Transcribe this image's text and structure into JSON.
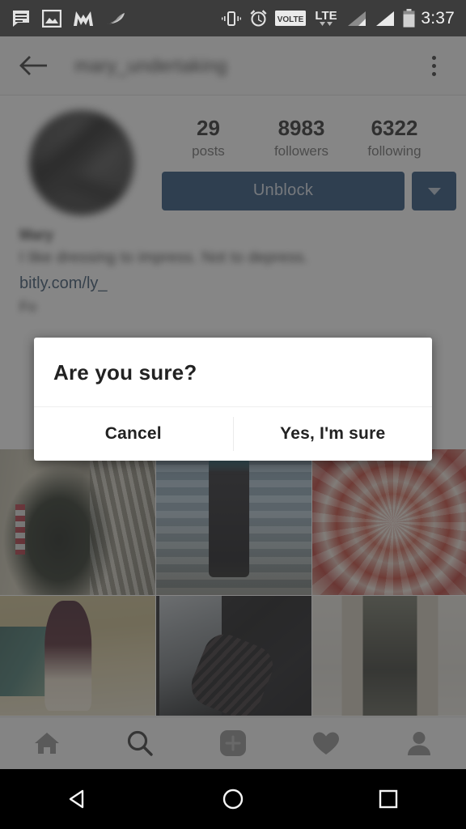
{
  "status_bar": {
    "background": "#3c3c3c",
    "time": "3:37",
    "left_icons": [
      {
        "name": "messages-icon",
        "label": "messages"
      },
      {
        "name": "photo-icon",
        "label": "photo"
      },
      {
        "name": "m-logo-icon",
        "label": "M"
      },
      {
        "name": "bird-icon",
        "label": "bird"
      }
    ],
    "right_icons": [
      {
        "name": "vibrate-icon",
        "label": "vibrate"
      },
      {
        "name": "alarm-icon",
        "label": "alarm"
      },
      {
        "name": "volte-icon",
        "label": "VOLTE"
      },
      {
        "name": "lte-icon",
        "label": "LTE"
      },
      {
        "name": "signal-icon-1",
        "label": "signal"
      },
      {
        "name": "signal-icon-2",
        "label": "signal"
      },
      {
        "name": "battery-icon",
        "label": "battery"
      }
    ]
  },
  "action_bar": {
    "back_label": "",
    "title": "mary_undertaking",
    "overflow_label": ""
  },
  "profile": {
    "stats": [
      {
        "number": "29",
        "label": "posts"
      },
      {
        "number": "8983",
        "label": "followers"
      },
      {
        "number": "6322",
        "label": "following"
      }
    ],
    "unblock_label": "Unblock",
    "dropdown_label": "",
    "bio_name": "Mary",
    "bio_text": "I like dressing to impress. Not to depress.",
    "bio_link": "bitly.com/ly_",
    "bio_tail": "Fo",
    "button_color": "#1c4471",
    "link_color": "#2f4b66"
  },
  "grid": {
    "tiles": [
      {
        "name": "post-thumbnail-1",
        "description": "christmas tree in station"
      },
      {
        "name": "post-thumbnail-2",
        "description": "person in dark outfit by wall"
      },
      {
        "name": "post-thumbnail-3",
        "description": "red and white flower"
      },
      {
        "name": "post-thumbnail-4",
        "description": "woman on beach"
      },
      {
        "name": "post-thumbnail-5",
        "description": "dark denim and boots"
      },
      {
        "name": "post-thumbnail-6",
        "description": "person in cardigan"
      }
    ]
  },
  "bottom_nav": {
    "items": [
      {
        "name": "nav-home",
        "label": "home"
      },
      {
        "name": "nav-search",
        "label": "search",
        "active": true
      },
      {
        "name": "nav-add",
        "label": "add"
      },
      {
        "name": "nav-activity",
        "label": "activity"
      },
      {
        "name": "nav-profile",
        "label": "profile"
      }
    ]
  },
  "dialog": {
    "title": "Are you sure?",
    "cancel_label": "Cancel",
    "confirm_label": "Yes, I'm sure"
  },
  "android_nav": {
    "back_label": "back",
    "home_label": "home",
    "recents_label": "recents"
  }
}
